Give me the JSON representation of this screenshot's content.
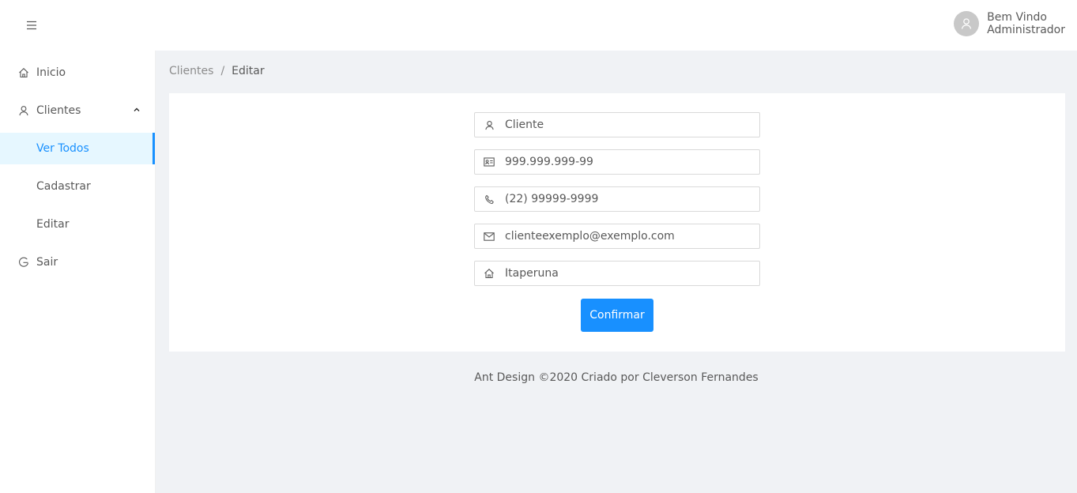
{
  "header": {
    "menu_toggle_icon": "menu-icon",
    "user": {
      "line1": "Bem Vindo",
      "line2": "Administrador",
      "avatar_icon": "user-icon"
    }
  },
  "sidebar": {
    "items": [
      {
        "label": "Inicio",
        "icon": "home-icon"
      },
      {
        "label": "Clientes",
        "icon": "user-icon",
        "expanded": true
      },
      {
        "label": "Ver Todos",
        "selected": true
      },
      {
        "label": "Cadastrar"
      },
      {
        "label": "Editar"
      },
      {
        "label": "Sair",
        "icon": "logout-icon"
      }
    ]
  },
  "breadcrumb": {
    "parent": "Clientes",
    "separator": "/",
    "current": "Editar"
  },
  "form": {
    "fields": [
      {
        "placeholder": "Cliente",
        "icon": "user-icon"
      },
      {
        "placeholder": "999.999.999-99",
        "icon": "idcard-icon"
      },
      {
        "placeholder": "(22) 99999-9999",
        "icon": "phone-icon"
      },
      {
        "placeholder": "clienteexemplo@exemplo.com",
        "icon": "mail-icon"
      },
      {
        "placeholder": "Itaperuna",
        "icon": "home-icon"
      }
    ],
    "submit_label": "Confirmar"
  },
  "footer": {
    "text": "Ant Design ©2020 Criado por Cleverson Fernandes"
  },
  "colors": {
    "primary": "#1890ff",
    "background": "#f0f2f5",
    "selected_bg": "#e6f7ff"
  }
}
